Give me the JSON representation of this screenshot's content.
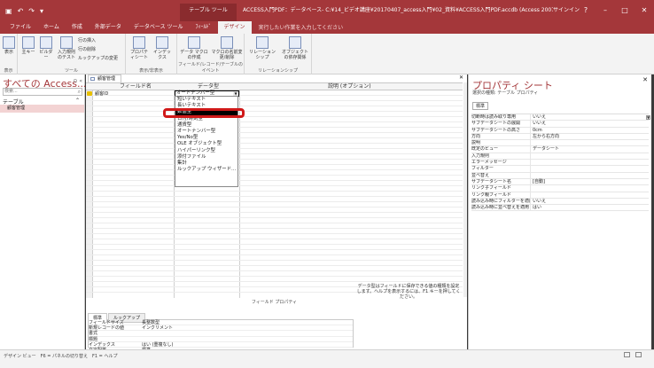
{
  "app": {
    "tool_context": "テーブル ツール",
    "window_title": "ACCESS入門PDF：データベース- C:¥14_ビデオ講座¥20170407_access入門¥02_資料¥ACCESS入門PDF.accdb (Access 2007 - 2016 ファイル形式) - ...",
    "signin": "サインイン",
    "win_help": "?",
    "win_min": "–",
    "win_max": "□",
    "win_close": "✕"
  },
  "menu": {
    "items": [
      "ファイル",
      "ホーム",
      "作成",
      "外部データ",
      "データベース ツール",
      "ﾌｨｰﾙﾄﾞ",
      "デザイン"
    ],
    "active": "デザイン",
    "tellme": "実行したい作業を入力してください"
  },
  "ribbon": {
    "view": "表示",
    "view_group": "表示",
    "primary_key": "主キー",
    "builder": "ビルダー",
    "validate": "入力規則のテスト",
    "insert_rows": "行の挿入",
    "delete_rows": "行の削除",
    "modify_lookups": "ルックアップの変更",
    "tools_group": "ツール",
    "property_sheet": "プロパティシート",
    "indexes": "インデックス",
    "showhide_group": "表示/非表示",
    "data_macro": "データ マクロの作成",
    "rename_macro": "マクロの名前変更/削除",
    "events_group": "フィールド/レコード/テーブルのイベント",
    "relationships": "リレーションシップ",
    "dependencies": "オブジェクトの依存関係",
    "relations_group": "リレーションシップ"
  },
  "nav": {
    "title": "すべての Access...",
    "search_placeholder": "検索...",
    "group": "テーブル",
    "item": "顧客管理"
  },
  "doc": {
    "tab": "顧客管理",
    "col_field": "フィールド名",
    "col_type": "データ型",
    "col_desc": "説明 (オプション)",
    "row1_field": "顧客ID",
    "row1_type": "オートナンバー型",
    "dropdown": [
      "短いテキスト",
      "長いテキスト",
      "数値型",
      "日付/時刻型",
      "通貨型",
      "オートナンバー型",
      "Yes/No型",
      "OLE オブジェクト型",
      "ハイパーリンク型",
      "添付ファイル",
      "集計",
      "ルックアップ ウィザード..."
    ],
    "selected_option": "数値型",
    "field_props_caption": "フィールド プロパティ"
  },
  "field_props": {
    "tabs": [
      "標準",
      "ルックアップ"
    ],
    "rows": [
      {
        "k": "フィールドサイズ",
        "v": "長整数型"
      },
      {
        "k": "新規レコードの値",
        "v": "インクリメント"
      },
      {
        "k": "書式",
        "v": ""
      },
      {
        "k": "標題",
        "v": ""
      },
      {
        "k": "インデックス",
        "v": "はい (重複なし)"
      },
      {
        "k": "文字配置",
        "v": "標準"
      }
    ],
    "help": "データ型はフィールドに保存できる値の種類を設定します。ヘルプを表示するには、F1 キーを押してください。"
  },
  "property_sheet": {
    "title": "プロパティ シート",
    "subtitle": "選択の種類: テーブル プロパティ",
    "tab": "標準",
    "rows": [
      {
        "k": "切断時は読み取り専用",
        "v": "いいえ"
      },
      {
        "k": "サブデータシートの展開",
        "v": "いいえ"
      },
      {
        "k": "サブデータシートの高さ",
        "v": "0cm"
      },
      {
        "k": "方向",
        "v": "左から右方向"
      },
      {
        "k": "説明",
        "v": ""
      },
      {
        "k": "既定のビュー",
        "v": "データシート"
      },
      {
        "k": "入力規則",
        "v": ""
      },
      {
        "k": "エラーメッセージ",
        "v": ""
      },
      {
        "k": "フィルター",
        "v": ""
      },
      {
        "k": "並べ替え",
        "v": ""
      },
      {
        "k": "サブデータシート名",
        "v": "[自動]"
      },
      {
        "k": "リンク子フィールド",
        "v": ""
      },
      {
        "k": "リンク親フィールド",
        "v": ""
      },
      {
        "k": "読み込み時にフィルターを適用",
        "v": "いいえ"
      },
      {
        "k": "読み込み時に並べ替えを適用",
        "v": "はい"
      }
    ]
  },
  "status": {
    "text": "デザイン ビュー　F6 = パネルの切り替え　F1 = ヘルプ"
  }
}
